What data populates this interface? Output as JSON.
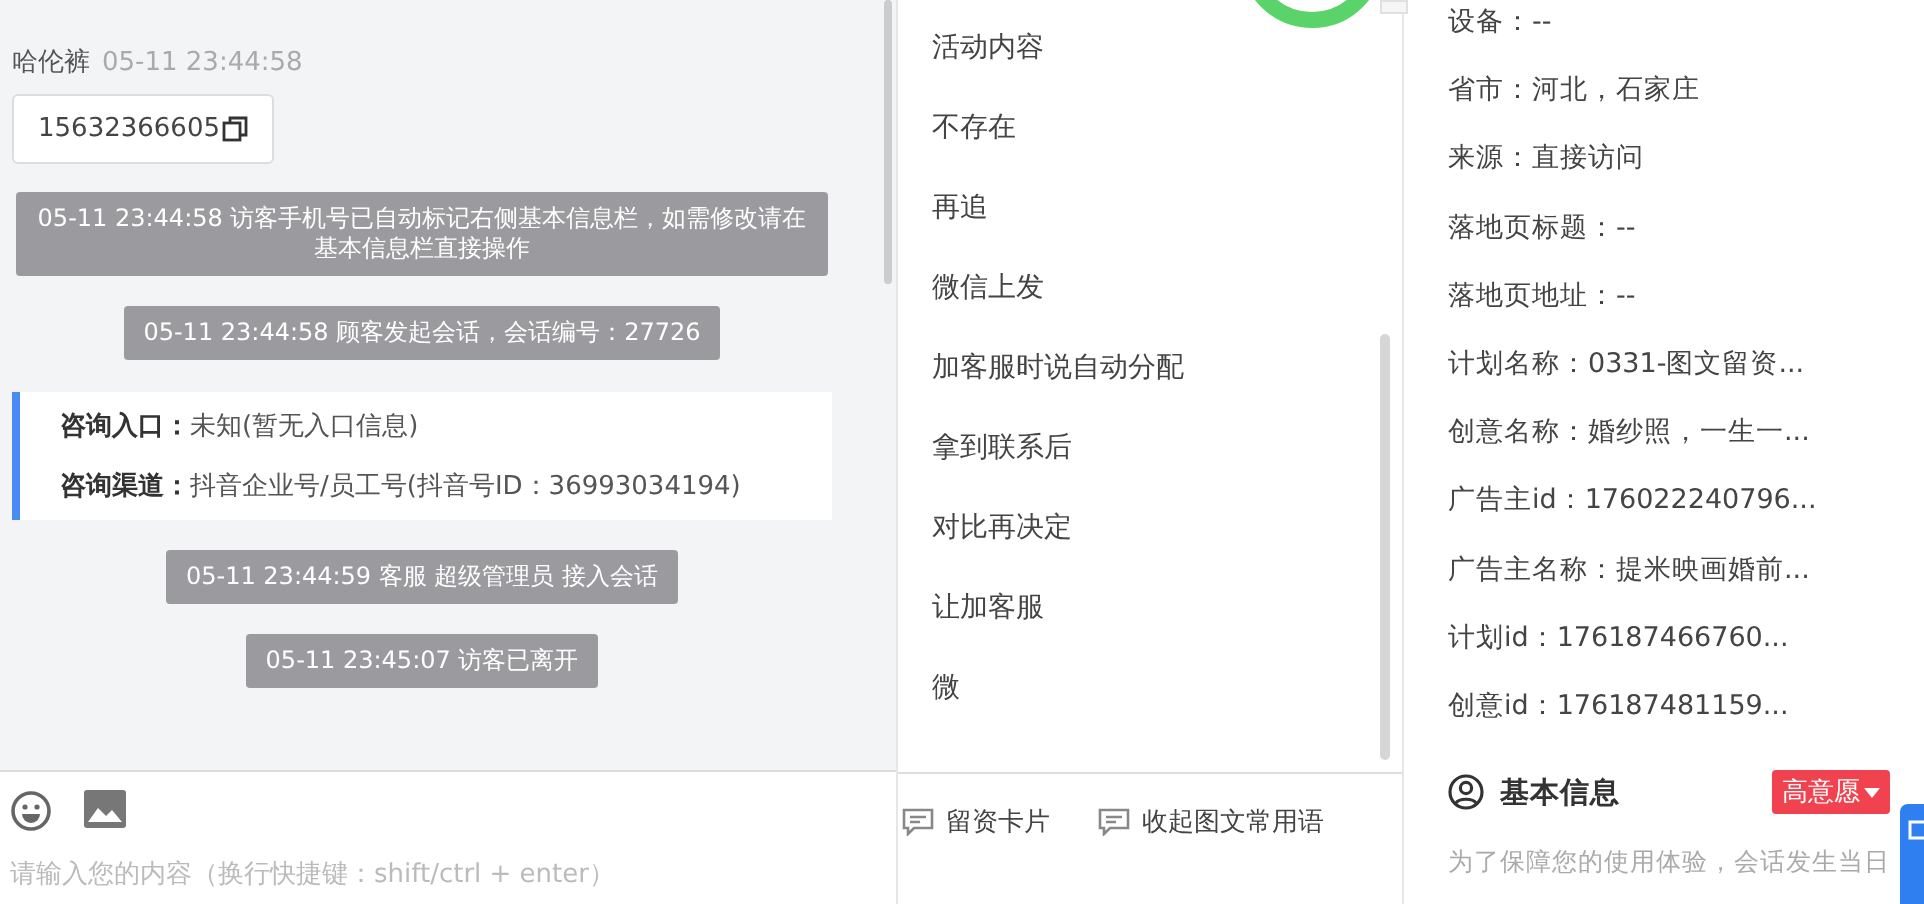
{
  "chat": {
    "sender": "哈伦裤",
    "sent_time": "05-11 23:44:58",
    "phone": "15632366605",
    "events": [
      {
        "kind": "notice",
        "text": "05-11 23:44:58 访客手机号已自动标记右侧基本信息栏，如需修改请在基本信息栏直接操作"
      },
      {
        "kind": "notice",
        "text": "05-11 23:44:58 顾客发起会话，会话编号：27726"
      },
      {
        "kind": "info",
        "lines": [
          {
            "label": "咨询入口：",
            "value": "未知(暂无入口信息)"
          },
          {
            "label": "咨询渠道：",
            "value": "抖音企业号/员工号(抖音号ID：36993034194)"
          }
        ]
      },
      {
        "kind": "notice",
        "text": "05-11 23:44:59 客服 超级管理员 接入会话"
      },
      {
        "kind": "notice",
        "text": "05-11 23:45:07 访客已离开"
      }
    ],
    "input": {
      "placeholder": "请输入您的内容（换行快捷键：shift/ctrl + enter）"
    }
  },
  "phrases": {
    "items": [
      "活动内容",
      "不存在",
      "再追",
      "微信上发",
      "加客服时说自动分配",
      "拿到联系后",
      "对比再决定",
      "让加客服",
      "微"
    ],
    "actions": [
      "留资卡片",
      "收起图文常用语"
    ]
  },
  "details": {
    "fields": [
      "设备：--",
      "省市：河北，石家庄",
      "来源：直接访问",
      "落地页标题：--",
      "落地页地址：--",
      "计划名称：0331-图文留资...",
      "创意名称：婚纱照，一生一...",
      "广告主id：176022240796...",
      "广告主名称：提米映画婚前...",
      "计划id：176187466760...",
      "创意id：176187481159..."
    ],
    "section_title": "基本信息",
    "intent_tag": "高意愿",
    "note": "为了保障您的使用体验，会话发生当日"
  }
}
